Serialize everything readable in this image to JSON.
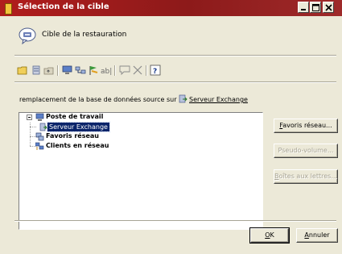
{
  "window": {
    "title": "Sélection de la cible"
  },
  "header": {
    "text": "Cible de la restauration"
  },
  "toolbar": {
    "icons": [
      "open-folder-icon",
      "server-add-icon",
      "folder-up-icon",
      "computer-icon",
      "network-icon",
      "flag-icon",
      "text-edit-icon",
      "comment-icon",
      "delete-icon",
      "help-icon"
    ]
  },
  "replacement": {
    "prefix": "remplacement de la base de données source sur",
    "target": "Serveur Exchange"
  },
  "tree": {
    "nodes": [
      {
        "label": "Poste de travail",
        "expanded": true
      },
      {
        "label": "Serveur Exchange",
        "selected": true
      },
      {
        "label": "Favoris réseau"
      },
      {
        "label": "Clients en réseau"
      }
    ]
  },
  "buttons": {
    "favoris": {
      "mnemonic": "F",
      "rest": "avoris réseau..."
    },
    "pseudo": {
      "label": "Pseudo-volume..."
    },
    "boites": {
      "mnemonic": "B",
      "rest": "oîtes aux lettres..."
    },
    "ok": {
      "mnemonic": "O",
      "rest": "K"
    },
    "annuler": {
      "mnemonic": "A",
      "rest": "nnuler"
    }
  },
  "colors": {
    "titlebar": "#9e1c1c",
    "selection": "#0a246a",
    "dialog": "#ece9d8"
  }
}
